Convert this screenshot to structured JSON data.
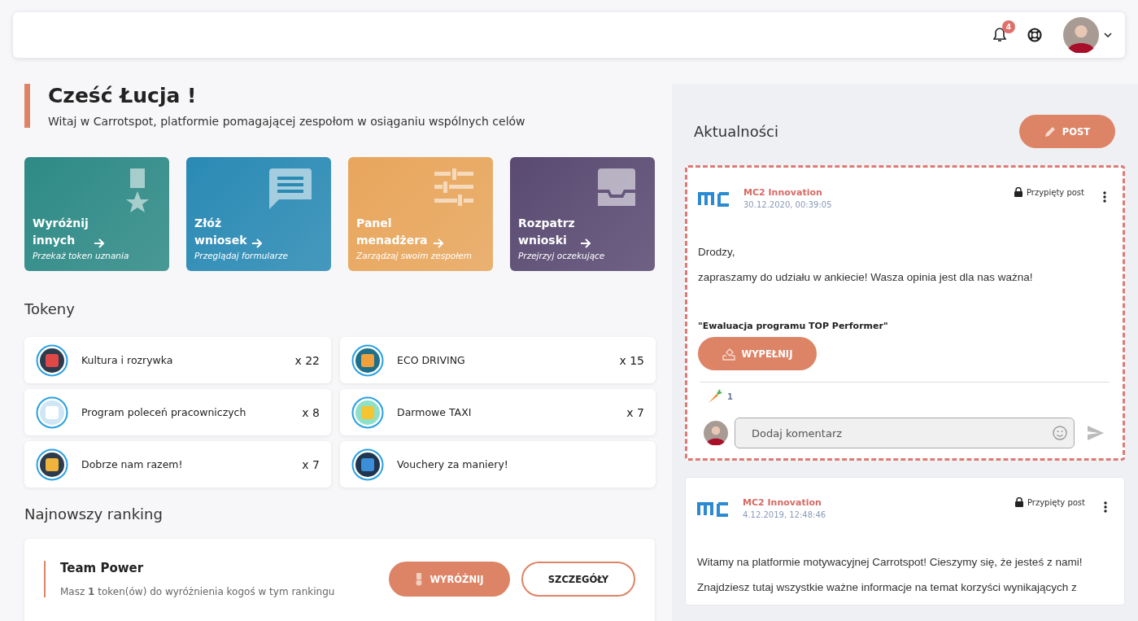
{
  "header": {
    "notifications_count": "4"
  },
  "greeting": {
    "title": "Cześć Łucja !",
    "subtitle": "Witaj w Carrotspot, platformie pomagającej zespołom w osiąganiu wspólnych celów"
  },
  "tiles": [
    {
      "kind": "medal",
      "title": "Wyróżnij\ninnych",
      "subtitle": "Przekaż token uznania",
      "color": "#2e8a86"
    },
    {
      "kind": "chat",
      "title": "Złóż\nwniosek",
      "subtitle": "Przeglądaj formularze",
      "color": "#2a8ab4"
    },
    {
      "kind": "sliders",
      "title": "Panel\nmenadżera",
      "subtitle": "Zarządzaj swoim zespołem",
      "color": "#e8a65c"
    },
    {
      "kind": "inbox",
      "title": "Rozpatrz\nwnioski",
      "subtitle": "Przejrzyj oczekujące",
      "color": "#5a4a72"
    }
  ],
  "tokens": {
    "title": "Tokeny",
    "items": [
      {
        "kind": "glasses",
        "name": "Kultura i rozrywka",
        "count": "x 22"
      },
      {
        "kind": "pump",
        "name": "ECO DRIVING",
        "count": "x 15"
      },
      {
        "kind": "document",
        "name": "Program poleceń pracowniczych",
        "count": "x 8"
      },
      {
        "kind": "taxi",
        "name": "Darmowe TAXI",
        "count": "x 7"
      },
      {
        "kind": "plant",
        "name": "Dobrze nam razem!",
        "count": "x 7"
      },
      {
        "kind": "drink",
        "name": "Vouchery za maniery!"
      }
    ]
  },
  "ranking": {
    "title": "Najnowszy ranking",
    "team": "Team Power",
    "info": "Masz **1** token(ów) do wyróżnienia kogoś w tym rankingu",
    "buttons": [
      "WYRÓŻNIJ",
      "SZCZEGÓŁY"
    ]
  },
  "news": {
    "title": "Aktualności",
    "post_button": "POST",
    "posts": [
      {
        "highlighted": true,
        "author": "MC2 Innovation",
        "date": "30.12.2020, 00:39:05",
        "pinned": "Przypięty post",
        "paragraphs": [
          "Drodzy,",
          "zapraszamy do udziału w ankiecie! Wasza opinia jest dla nas ważna!"
        ],
        "survey_title": "\"Ewaluacja programu TOP Performer\"",
        "survey_button": "WYPEŁNIJ",
        "reactions": "1",
        "comment_placeholder": "Dodaj komentarz"
      },
      {
        "highlighted": false,
        "author": "MC2 Innovation",
        "date": "4.12.2019, 12:48:46",
        "pinned": "Przypięty post",
        "paragraphs": [
          "Witamy na platformie motywacyjnej Carrotspot! Cieszymy się, że jesteś z nami!",
          "Znajdziesz tutaj wszystkie ważne informacje na temat korzyści wynikających z"
        ]
      }
    ]
  }
}
